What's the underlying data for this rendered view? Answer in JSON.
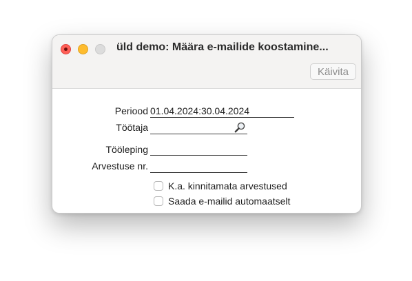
{
  "window": {
    "title": "üld demo: Määra e-mailide koostamine..."
  },
  "toolbar": {
    "run_label": "Käivita"
  },
  "form": {
    "period": {
      "label": "Periood",
      "value": "01.04.2024:30.04.2024"
    },
    "employee": {
      "label": "Töötaja",
      "value": ""
    },
    "contract": {
      "label": "Tööleping",
      "value": ""
    },
    "payroll_no": {
      "label": "Arvestuse nr.",
      "value": ""
    },
    "include_unconfirmed": {
      "label": "K.a. kinnitamata arvestused",
      "checked": false
    },
    "send_automatically": {
      "label": "Saada e-mailid automaatselt",
      "checked": false
    }
  },
  "icons": {
    "lookup": "magnifier-icon"
  },
  "colors": {
    "close": "#ff5f57",
    "minimize": "#febc2e",
    "zoom_disabled": "#dcdcdc"
  }
}
